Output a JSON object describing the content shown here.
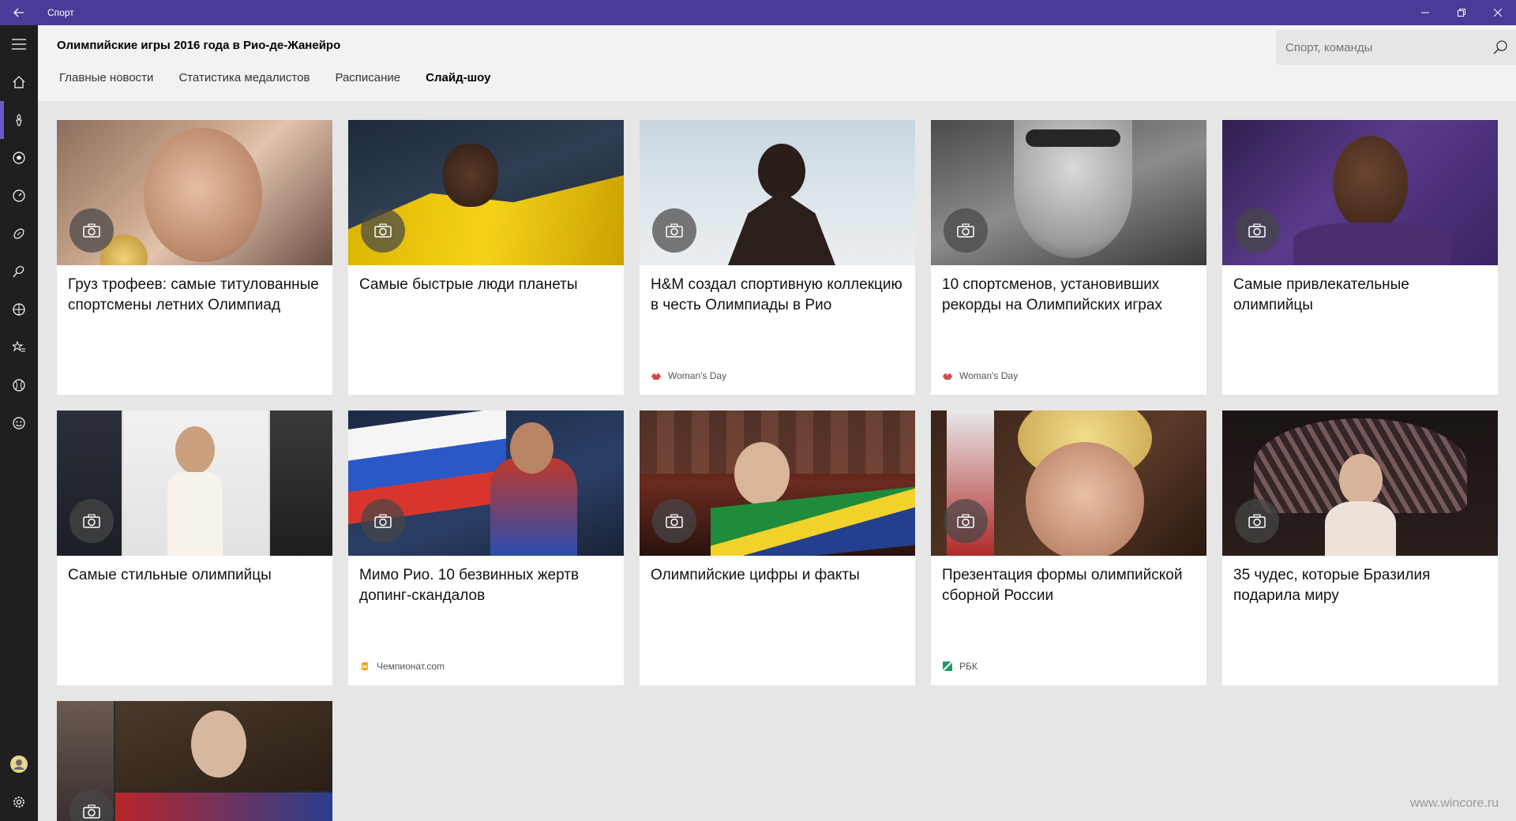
{
  "window": {
    "app_title": "Спорт",
    "back_icon": "back-arrow-icon",
    "minimize_icon": "minimize-icon",
    "maximize_icon": "restore-icon",
    "close_icon": "close-icon"
  },
  "rail": {
    "items": [
      {
        "icon": "hamburger-menu-icon"
      },
      {
        "icon": "home-icon"
      },
      {
        "icon": "torch-icon",
        "active": true
      },
      {
        "icon": "soccer-ball-icon"
      },
      {
        "icon": "stopwatch-icon"
      },
      {
        "icon": "american-football-icon"
      },
      {
        "icon": "tennis-icon"
      },
      {
        "icon": "basketball-icon"
      },
      {
        "icon": "favorites-star-icon"
      },
      {
        "icon": "baseball-icon"
      },
      {
        "icon": "emoji-icon"
      },
      {
        "icon": "account-avatar-icon"
      },
      {
        "icon": "settings-gear-icon"
      }
    ]
  },
  "header": {
    "title": "Олимпийские игры 2016 года в Рио-де-Жанейро",
    "search_placeholder": "Спорт, команды",
    "tabs": [
      {
        "label": "Главные новости"
      },
      {
        "label": "Статистика медалистов"
      },
      {
        "label": "Расписание"
      },
      {
        "label": "Слайд-шоу",
        "selected": true
      }
    ]
  },
  "cards": [
    {
      "title": "Груз трофеев: самые титулованные спортсмены летних Олимпиад",
      "source": "",
      "image": "swimmer-with-gold-medal"
    },
    {
      "title": "Самые быстрые люди планеты",
      "source": "",
      "image": "sprinter-in-yellow"
    },
    {
      "title": "H&M создал спортивную коллекцию в честь Олимпиады в Рио",
      "source": "Woman's Day",
      "image": "athlete-on-sky"
    },
    {
      "title": "10 спортсменов, установивших рекорды на Олимпийских играх",
      "source": "Woman's Day",
      "image": "swimmer-bw"
    },
    {
      "title": "Самые привлекательные олимпийцы",
      "source": "",
      "image": "gymnast-purple"
    },
    {
      "title": "Самые стильные олимпийцы",
      "source": "",
      "image": "tennis-player-collage"
    },
    {
      "title": "Мимо Рио. 10 безвинных жертв допинг-скандалов",
      "source": "Чемпионат.com",
      "image": "runner-russia-flag"
    },
    {
      "title": "Олимпийские цифры и факты",
      "source": "",
      "image": "crowd-brazil-flag"
    },
    {
      "title": "Презентация формы олимпийской сборной России",
      "source": "РБК",
      "image": "woman-blonde"
    },
    {
      "title": "35 чудес, которые Бразилия подарила миру",
      "source": "",
      "image": "carnival-costume"
    },
    {
      "title": "",
      "source": "",
      "image": "officials-collage"
    }
  ],
  "colors": {
    "titlebar": "#4b3a97",
    "rail": "#1f1f1f",
    "accent": "#6b5bc4"
  },
  "watermark": "www.wincore.ru"
}
